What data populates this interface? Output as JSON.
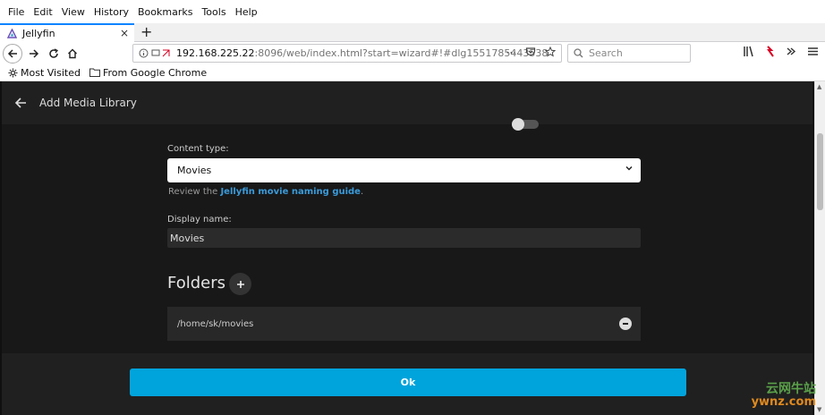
{
  "menu": {
    "file": "File",
    "edit": "Edit",
    "view": "View",
    "history": "History",
    "bookmarks": "Bookmarks",
    "tools": "Tools",
    "help": "Help"
  },
  "tab": {
    "title": "Jellyfin",
    "close": "×",
    "new_tab": "+"
  },
  "nav": {
    "url_host": "192.168.225.22",
    "url_rest": ":8096/web/index.html?start=wizard#!#dlg1551785443538",
    "search_placeholder": "Search",
    "more": "···"
  },
  "bookmarks_bar": {
    "items": [
      {
        "label": "Most Visited",
        "icon": "gear-icon"
      },
      {
        "label": "From Google Chrome",
        "icon": "folder-icon"
      }
    ]
  },
  "dialog": {
    "title": "Add Media Library",
    "content_type_label": "Content type:",
    "content_type_value": "Movies",
    "help_prefix": "Review the ",
    "help_link": "Jellyfin movie naming guide",
    "help_suffix": ".",
    "display_name_label": "Display name:",
    "display_name_value": "Movies",
    "folders_title": "Folders",
    "folders": [
      "/home/sk/movies"
    ],
    "ok_label": "Ok"
  },
  "watermark": {
    "line1": "云网牛站",
    "line2": "ywnz.com"
  },
  "colors": {
    "accent": "#00a4dc",
    "link": "#3a9ad9",
    "page_bg": "#101010"
  }
}
